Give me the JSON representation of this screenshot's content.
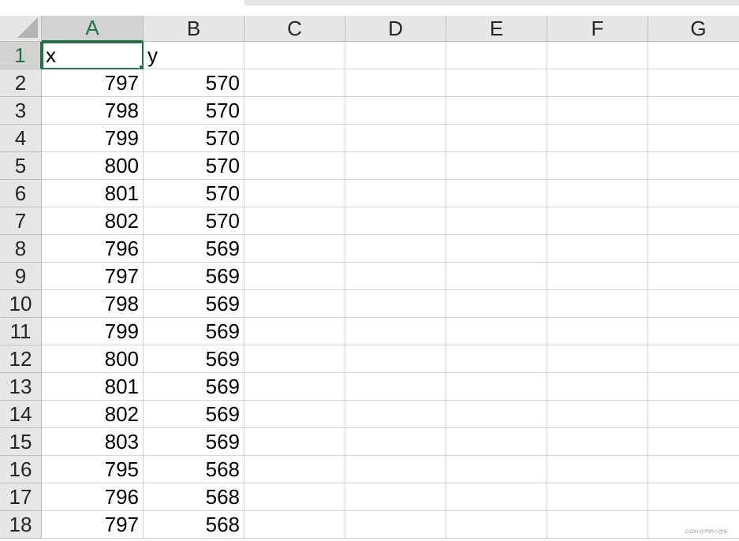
{
  "columns": [
    "A",
    "B",
    "C",
    "D",
    "E",
    "F",
    "G"
  ],
  "rows": [
    {
      "num": "1",
      "a": "x",
      "b": "y"
    },
    {
      "num": "2",
      "a": "797",
      "b": "570"
    },
    {
      "num": "3",
      "a": "798",
      "b": "570"
    },
    {
      "num": "4",
      "a": "799",
      "b": "570"
    },
    {
      "num": "5",
      "a": "800",
      "b": "570"
    },
    {
      "num": "6",
      "a": "801",
      "b": "570"
    },
    {
      "num": "7",
      "a": "802",
      "b": "570"
    },
    {
      "num": "8",
      "a": "796",
      "b": "569"
    },
    {
      "num": "9",
      "a": "797",
      "b": "569"
    },
    {
      "num": "10",
      "a": "798",
      "b": "569"
    },
    {
      "num": "11",
      "a": "799",
      "b": "569"
    },
    {
      "num": "12",
      "a": "800",
      "b": "569"
    },
    {
      "num": "13",
      "a": "801",
      "b": "569"
    },
    {
      "num": "14",
      "a": "802",
      "b": "569"
    },
    {
      "num": "15",
      "a": "803",
      "b": "569"
    },
    {
      "num": "16",
      "a": "795",
      "b": "568"
    },
    {
      "num": "17",
      "a": "796",
      "b": "568"
    },
    {
      "num": "18",
      "a": "797",
      "b": "568"
    }
  ],
  "selected_cell": "A1",
  "colors": {
    "accent": "#217346",
    "header_bg": "#e6e6e6",
    "gridline": "#d4d4d4"
  },
  "watermark": "CSDN @代码小团长"
}
